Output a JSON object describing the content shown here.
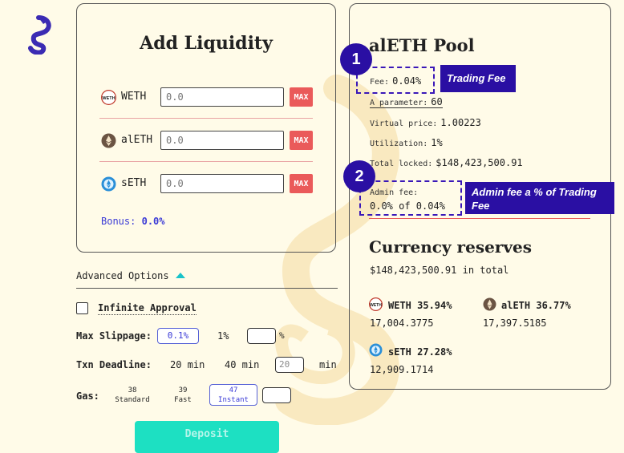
{
  "icons": {
    "logo": "seahorse-logo-icon",
    "weth": "weth-token-icon",
    "aleth": "aleth-token-icon",
    "seth": "seth-token-icon",
    "advanced_toggle": "triangle-up-icon"
  },
  "colors": {
    "accent_blue": "#3a3ad6",
    "max_red": "#ea5a5a",
    "deposit_teal": "#1de0c2",
    "annotation_purple": "#2a0fa3"
  },
  "deposit_form": {
    "title": "Add Liquidity",
    "tokens": [
      {
        "name": "WETH",
        "placeholder": "0.0",
        "max_label": "MAX"
      },
      {
        "name": "alETH",
        "placeholder": "0.0",
        "max_label": "MAX"
      },
      {
        "name": "sETH",
        "placeholder": "0.0",
        "max_label": "MAX"
      }
    ],
    "bonus_label": "Bonus:",
    "bonus_value": "0.0%"
  },
  "advanced": {
    "label": "Advanced Options",
    "infinite_approval": "Infinite Approval",
    "max_slippage_label": "Max Slippage:",
    "slippage_options": [
      "0.1%",
      "1%"
    ],
    "slippage_unit": "%",
    "deadline_label": "Txn Deadline:",
    "deadline_options": [
      "20 min",
      "40 min"
    ],
    "deadline_placeholder": "20",
    "deadline_unit": "min",
    "gas_label": "Gas:",
    "gas_options": [
      {
        "value": "38",
        "label": "Standard"
      },
      {
        "value": "39",
        "label": "Fast"
      },
      {
        "value": "47",
        "label": "Instant"
      }
    ],
    "deposit_label": "Deposit"
  },
  "pool": {
    "title": "alETH Pool",
    "fee_label": "Fee:",
    "fee_value": "0.04%",
    "a_param_label": "A parameter:",
    "a_param_value": "60",
    "virtual_price_label": "Virtual price:",
    "virtual_price_value": "1.00223",
    "utilization_label": "Utilization:",
    "utilization_value": "1%",
    "total_locked_label": "Total locked:",
    "total_locked_value": "$148,423,500.91",
    "admin_fee_label": "Admin fee:",
    "admin_fee_value": "0.0% of 0.04%"
  },
  "reserves": {
    "title": "Currency reserves",
    "total": "$148,423,500.91 in total",
    "items": [
      {
        "name": "WETH 35.94%",
        "amount": "17,004.3775"
      },
      {
        "name": "alETH 36.77%",
        "amount": "17,397.5185"
      },
      {
        "name": "sETH 27.28%",
        "amount": "12,909.1714"
      }
    ]
  },
  "annotations": [
    {
      "number": "1",
      "text": "Trading Fee"
    },
    {
      "number": "2",
      "text": "Admin fee a % of Trading Fee"
    }
  ]
}
